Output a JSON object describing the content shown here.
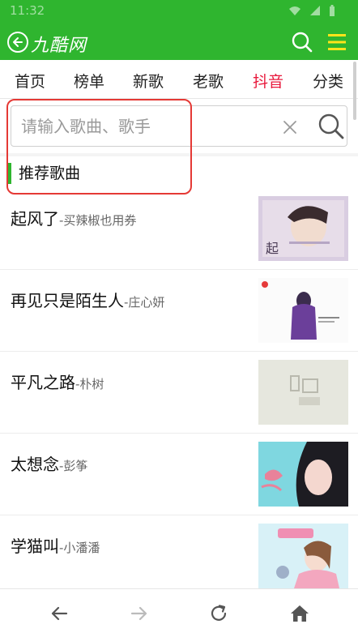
{
  "status": {
    "time": "11:32"
  },
  "header": {
    "brand": "九酷网"
  },
  "tabs": [
    {
      "label": "首页"
    },
    {
      "label": "榜单"
    },
    {
      "label": "新歌"
    },
    {
      "label": "老歌"
    },
    {
      "label": "抖音",
      "active": true
    },
    {
      "label": "分类"
    }
  ],
  "search": {
    "placeholder": "请输入歌曲、歌手",
    "value": ""
  },
  "section": {
    "title": "推荐歌曲"
  },
  "songs": [
    {
      "title": "起风了",
      "artist": "-买辣椒也用券",
      "cover_icon": "album-cover-qifengle"
    },
    {
      "title": "再见只是陌生人",
      "artist": "-庄心妍",
      "cover_icon": "album-cover-zaijian"
    },
    {
      "title": "平凡之路",
      "artist": "-朴树",
      "cover_icon": "album-cover-pingfan"
    },
    {
      "title": "太想念",
      "artist": "-彭筝",
      "cover_icon": "album-cover-taixiangnian"
    },
    {
      "title": "学猫叫",
      "artist": "-小潘潘",
      "cover_icon": "album-cover-xuemaojiao"
    }
  ],
  "colors": {
    "brand_green": "#2fb52f",
    "active_tab": "#e8193c",
    "highlight_border": "#e53935"
  }
}
